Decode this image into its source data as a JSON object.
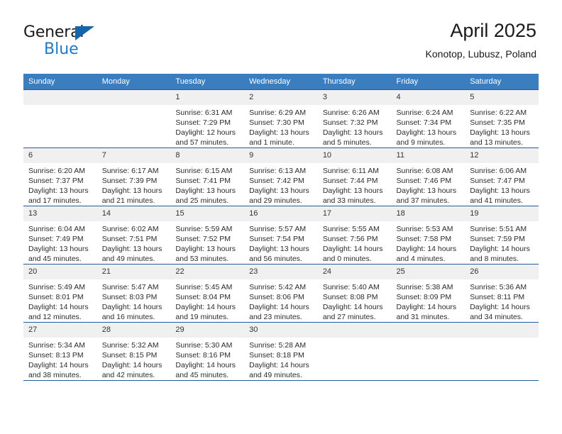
{
  "brand": {
    "name_top": "General",
    "name_bottom": "Blue",
    "accent_color": "#1f7ac4",
    "triangle_color": "#1565a8"
  },
  "header": {
    "title": "April 2025",
    "location": "Konotop, Lubusz, Poland"
  },
  "calendar": {
    "header_bg": "#3a7ebf",
    "row_border_color": "#1f5fa0",
    "daynum_bg": "#f0f0f0",
    "weekdays": [
      "Sunday",
      "Monday",
      "Tuesday",
      "Wednesday",
      "Thursday",
      "Friday",
      "Saturday"
    ],
    "weeks": [
      [
        {
          "day": "",
          "sunrise": "",
          "sunset": "",
          "daylight": "",
          "daylight2": ""
        },
        {
          "day": "",
          "sunrise": "",
          "sunset": "",
          "daylight": "",
          "daylight2": ""
        },
        {
          "day": "1",
          "sunrise": "Sunrise: 6:31 AM",
          "sunset": "Sunset: 7:29 PM",
          "daylight": "Daylight: 12 hours",
          "daylight2": "and 57 minutes."
        },
        {
          "day": "2",
          "sunrise": "Sunrise: 6:29 AM",
          "sunset": "Sunset: 7:30 PM",
          "daylight": "Daylight: 13 hours",
          "daylight2": "and 1 minute."
        },
        {
          "day": "3",
          "sunrise": "Sunrise: 6:26 AM",
          "sunset": "Sunset: 7:32 PM",
          "daylight": "Daylight: 13 hours",
          "daylight2": "and 5 minutes."
        },
        {
          "day": "4",
          "sunrise": "Sunrise: 6:24 AM",
          "sunset": "Sunset: 7:34 PM",
          "daylight": "Daylight: 13 hours",
          "daylight2": "and 9 minutes."
        },
        {
          "day": "5",
          "sunrise": "Sunrise: 6:22 AM",
          "sunset": "Sunset: 7:35 PM",
          "daylight": "Daylight: 13 hours",
          "daylight2": "and 13 minutes."
        }
      ],
      [
        {
          "day": "6",
          "sunrise": "Sunrise: 6:20 AM",
          "sunset": "Sunset: 7:37 PM",
          "daylight": "Daylight: 13 hours",
          "daylight2": "and 17 minutes."
        },
        {
          "day": "7",
          "sunrise": "Sunrise: 6:17 AM",
          "sunset": "Sunset: 7:39 PM",
          "daylight": "Daylight: 13 hours",
          "daylight2": "and 21 minutes."
        },
        {
          "day": "8",
          "sunrise": "Sunrise: 6:15 AM",
          "sunset": "Sunset: 7:41 PM",
          "daylight": "Daylight: 13 hours",
          "daylight2": "and 25 minutes."
        },
        {
          "day": "9",
          "sunrise": "Sunrise: 6:13 AM",
          "sunset": "Sunset: 7:42 PM",
          "daylight": "Daylight: 13 hours",
          "daylight2": "and 29 minutes."
        },
        {
          "day": "10",
          "sunrise": "Sunrise: 6:11 AM",
          "sunset": "Sunset: 7:44 PM",
          "daylight": "Daylight: 13 hours",
          "daylight2": "and 33 minutes."
        },
        {
          "day": "11",
          "sunrise": "Sunrise: 6:08 AM",
          "sunset": "Sunset: 7:46 PM",
          "daylight": "Daylight: 13 hours",
          "daylight2": "and 37 minutes."
        },
        {
          "day": "12",
          "sunrise": "Sunrise: 6:06 AM",
          "sunset": "Sunset: 7:47 PM",
          "daylight": "Daylight: 13 hours",
          "daylight2": "and 41 minutes."
        }
      ],
      [
        {
          "day": "13",
          "sunrise": "Sunrise: 6:04 AM",
          "sunset": "Sunset: 7:49 PM",
          "daylight": "Daylight: 13 hours",
          "daylight2": "and 45 minutes."
        },
        {
          "day": "14",
          "sunrise": "Sunrise: 6:02 AM",
          "sunset": "Sunset: 7:51 PM",
          "daylight": "Daylight: 13 hours",
          "daylight2": "and 49 minutes."
        },
        {
          "day": "15",
          "sunrise": "Sunrise: 5:59 AM",
          "sunset": "Sunset: 7:52 PM",
          "daylight": "Daylight: 13 hours",
          "daylight2": "and 53 minutes."
        },
        {
          "day": "16",
          "sunrise": "Sunrise: 5:57 AM",
          "sunset": "Sunset: 7:54 PM",
          "daylight": "Daylight: 13 hours",
          "daylight2": "and 56 minutes."
        },
        {
          "day": "17",
          "sunrise": "Sunrise: 5:55 AM",
          "sunset": "Sunset: 7:56 PM",
          "daylight": "Daylight: 14 hours",
          "daylight2": "and 0 minutes."
        },
        {
          "day": "18",
          "sunrise": "Sunrise: 5:53 AM",
          "sunset": "Sunset: 7:58 PM",
          "daylight": "Daylight: 14 hours",
          "daylight2": "and 4 minutes."
        },
        {
          "day": "19",
          "sunrise": "Sunrise: 5:51 AM",
          "sunset": "Sunset: 7:59 PM",
          "daylight": "Daylight: 14 hours",
          "daylight2": "and 8 minutes."
        }
      ],
      [
        {
          "day": "20",
          "sunrise": "Sunrise: 5:49 AM",
          "sunset": "Sunset: 8:01 PM",
          "daylight": "Daylight: 14 hours",
          "daylight2": "and 12 minutes."
        },
        {
          "day": "21",
          "sunrise": "Sunrise: 5:47 AM",
          "sunset": "Sunset: 8:03 PM",
          "daylight": "Daylight: 14 hours",
          "daylight2": "and 16 minutes."
        },
        {
          "day": "22",
          "sunrise": "Sunrise: 5:45 AM",
          "sunset": "Sunset: 8:04 PM",
          "daylight": "Daylight: 14 hours",
          "daylight2": "and 19 minutes."
        },
        {
          "day": "23",
          "sunrise": "Sunrise: 5:42 AM",
          "sunset": "Sunset: 8:06 PM",
          "daylight": "Daylight: 14 hours",
          "daylight2": "and 23 minutes."
        },
        {
          "day": "24",
          "sunrise": "Sunrise: 5:40 AM",
          "sunset": "Sunset: 8:08 PM",
          "daylight": "Daylight: 14 hours",
          "daylight2": "and 27 minutes."
        },
        {
          "day": "25",
          "sunrise": "Sunrise: 5:38 AM",
          "sunset": "Sunset: 8:09 PM",
          "daylight": "Daylight: 14 hours",
          "daylight2": "and 31 minutes."
        },
        {
          "day": "26",
          "sunrise": "Sunrise: 5:36 AM",
          "sunset": "Sunset: 8:11 PM",
          "daylight": "Daylight: 14 hours",
          "daylight2": "and 34 minutes."
        }
      ],
      [
        {
          "day": "27",
          "sunrise": "Sunrise: 5:34 AM",
          "sunset": "Sunset: 8:13 PM",
          "daylight": "Daylight: 14 hours",
          "daylight2": "and 38 minutes."
        },
        {
          "day": "28",
          "sunrise": "Sunrise: 5:32 AM",
          "sunset": "Sunset: 8:15 PM",
          "daylight": "Daylight: 14 hours",
          "daylight2": "and 42 minutes."
        },
        {
          "day": "29",
          "sunrise": "Sunrise: 5:30 AM",
          "sunset": "Sunset: 8:16 PM",
          "daylight": "Daylight: 14 hours",
          "daylight2": "and 45 minutes."
        },
        {
          "day": "30",
          "sunrise": "Sunrise: 5:28 AM",
          "sunset": "Sunset: 8:18 PM",
          "daylight": "Daylight: 14 hours",
          "daylight2": "and 49 minutes."
        },
        {
          "day": "",
          "sunrise": "",
          "sunset": "",
          "daylight": "",
          "daylight2": ""
        },
        {
          "day": "",
          "sunrise": "",
          "sunset": "",
          "daylight": "",
          "daylight2": ""
        },
        {
          "day": "",
          "sunrise": "",
          "sunset": "",
          "daylight": "",
          "daylight2": ""
        }
      ]
    ]
  }
}
